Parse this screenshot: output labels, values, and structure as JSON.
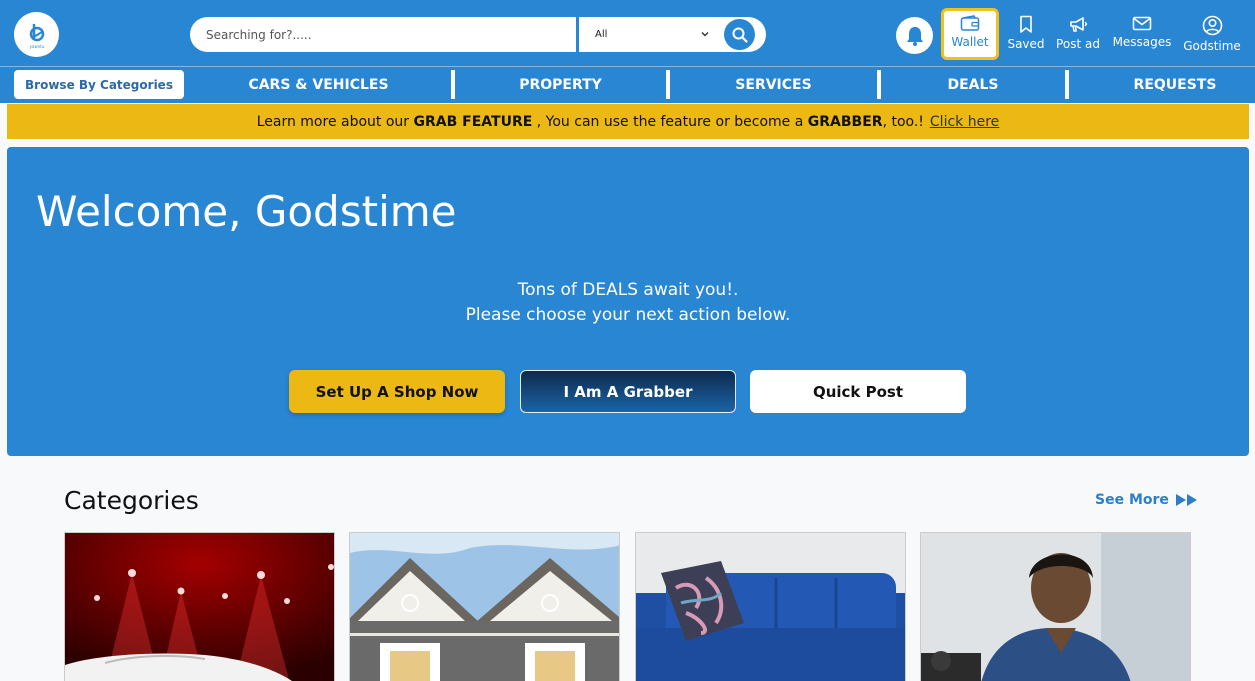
{
  "header": {
    "logo_text": "yawntu",
    "search_placeholder": "Searching for?.....",
    "search_scope": "All",
    "nav": {
      "wallet": "Wallet",
      "saved": "Saved",
      "post_ad": "Post ad",
      "messages": "Messages",
      "profile": "Godstime"
    }
  },
  "categories_nav": {
    "browse": "Browse By Categories",
    "items": [
      "CARS & VEHICLES",
      "PROPERTY",
      "SERVICES",
      "DEALS",
      "REQUESTS"
    ]
  },
  "promo": {
    "text_1": "Learn more about our",
    "bold_1": "GRAB FEATURE",
    "text_2": ", You can use the feature or become a",
    "bold_2": "GRABBER",
    "text_3": ", too.!",
    "link": "Click here"
  },
  "hero": {
    "welcome": "Welcome, Godstime",
    "line_1": "Tons of DEALS await you!.",
    "line_2": "Please choose your next action below.",
    "buttons": {
      "shop": "Set Up A Shop Now",
      "grabber": "I Am A Grabber",
      "quick_post": "Quick Post"
    }
  },
  "categories": {
    "title": "Categories",
    "see_more": "See More"
  },
  "colors": {
    "brand_blue": "#2886d3",
    "accent_yellow": "#ebb814"
  },
  "icons": [
    "search-icon",
    "chevron-down-icon",
    "bell-icon",
    "wallet-icon",
    "bookmark-icon",
    "megaphone-icon",
    "mail-icon",
    "user-circle-icon",
    "double-arrow-icon"
  ]
}
